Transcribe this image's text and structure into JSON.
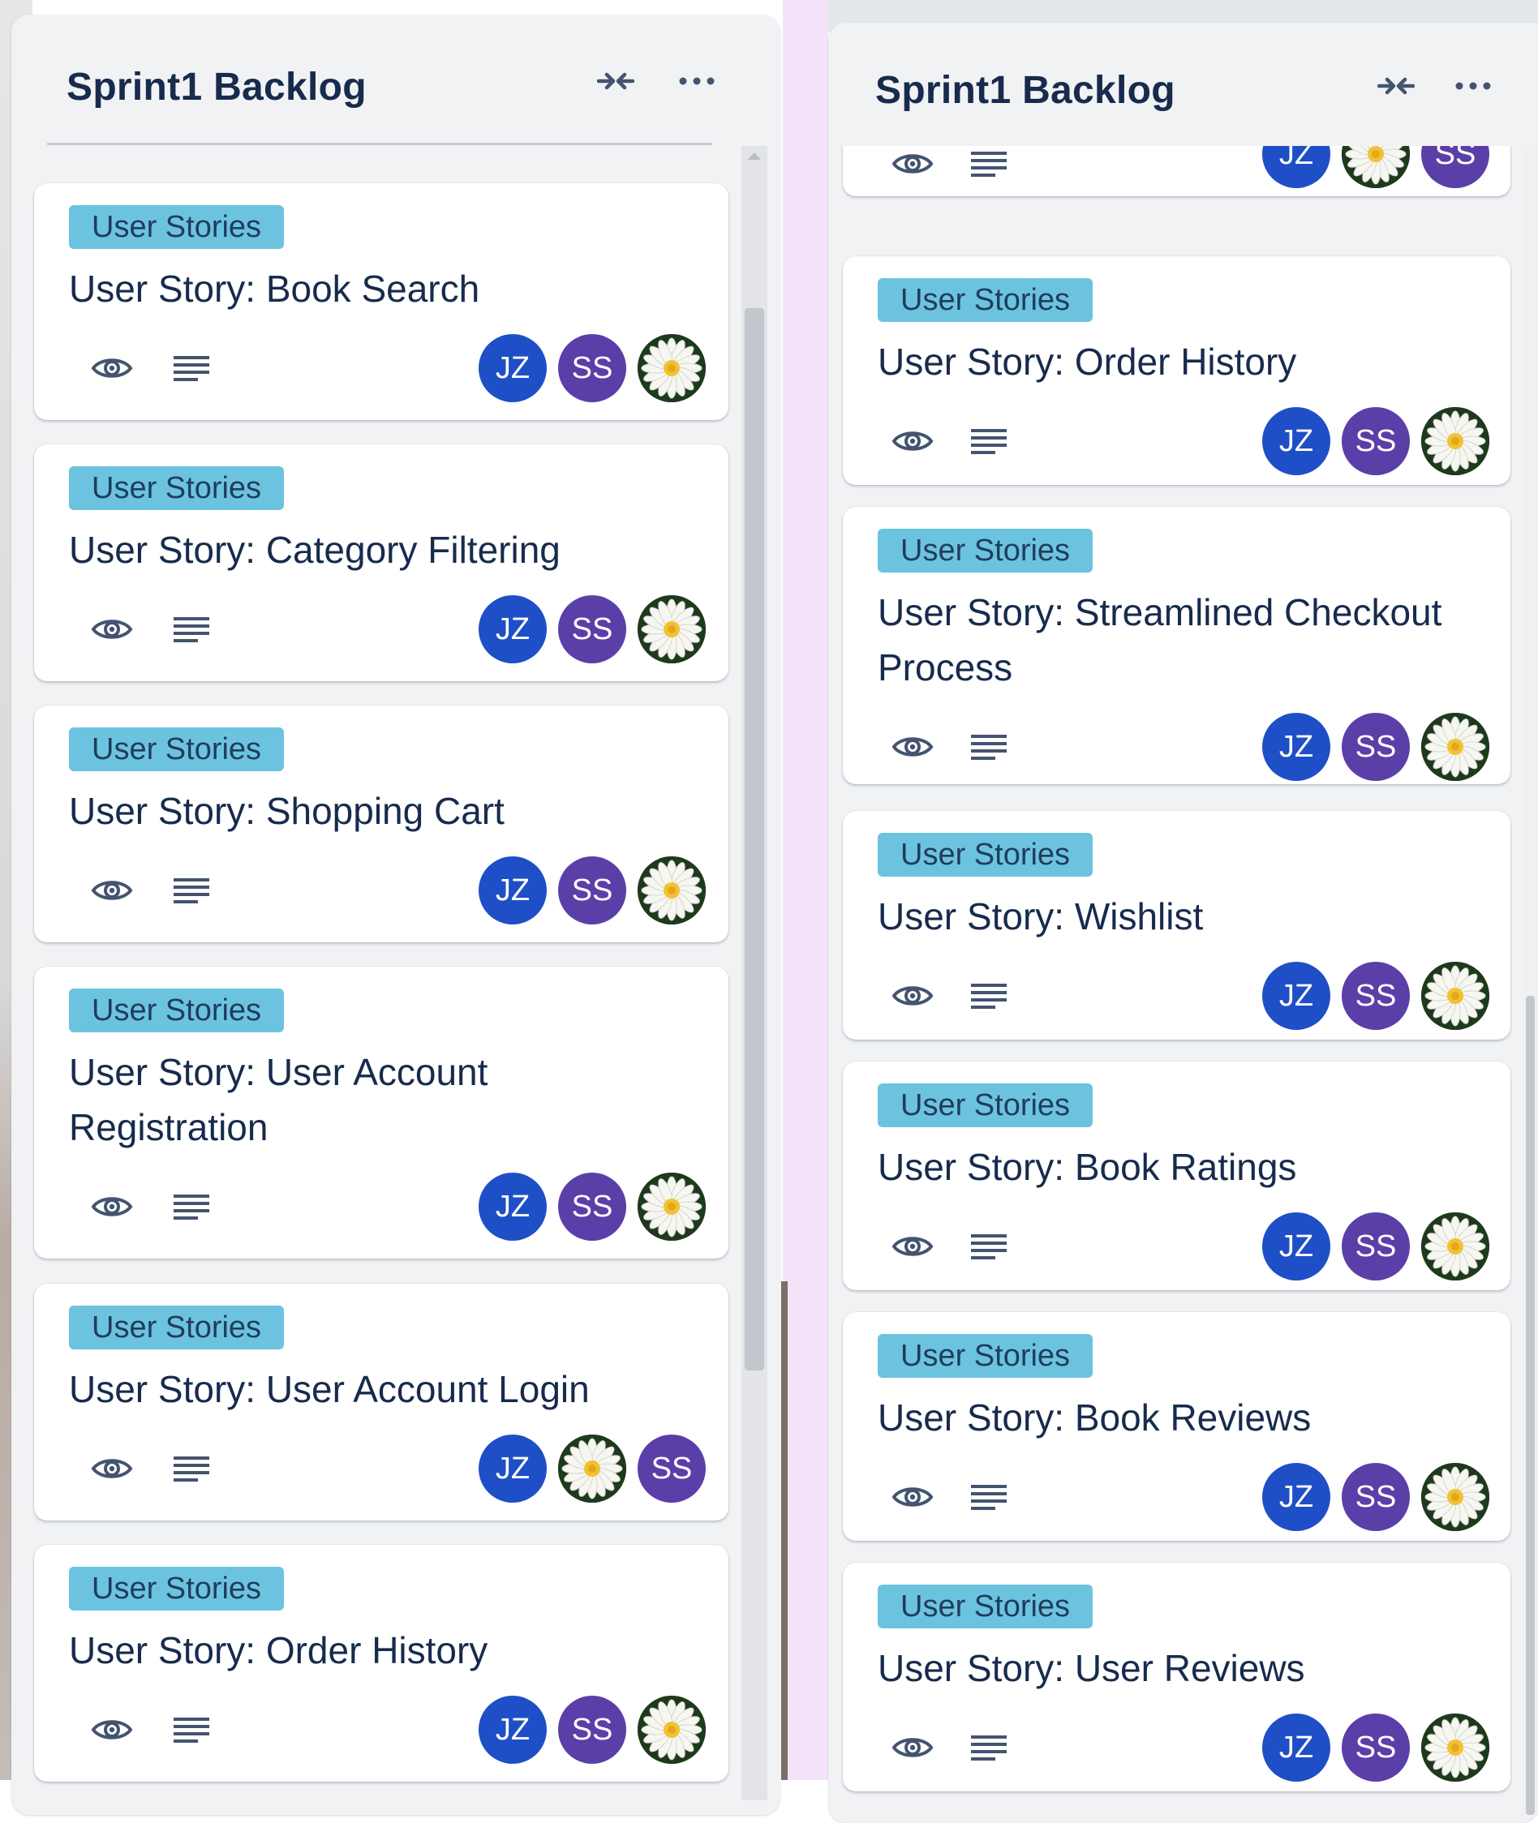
{
  "lists": [
    {
      "title": "Sprint1 Backlog",
      "cards": [
        {
          "label": "User Stories",
          "title": "User Story: Book Search",
          "members": [
            "JZ",
            "SS",
            "photo"
          ]
        },
        {
          "label": "User Stories",
          "title": "User Story: Category Filtering",
          "members": [
            "JZ",
            "SS",
            "photo"
          ]
        },
        {
          "label": "User Stories",
          "title": "User Story: Shopping Cart",
          "members": [
            "JZ",
            "SS",
            "photo"
          ]
        },
        {
          "label": "User Stories",
          "title": "User Story: User Account Registration",
          "members": [
            "JZ",
            "SS",
            "photo"
          ]
        },
        {
          "label": "User Stories",
          "title": "User Story: User Account Login",
          "members": [
            "JZ",
            "photo",
            "SS"
          ]
        },
        {
          "label": "User Stories",
          "title": "User Story: Order History",
          "members": [
            "JZ",
            "SS",
            "photo"
          ]
        }
      ]
    },
    {
      "title": "Sprint1 Backlog",
      "partial_card_members": [
        "JZ",
        "photo",
        "SS"
      ],
      "cards": [
        {
          "label": "User Stories",
          "title": "User Story: Order History",
          "members": [
            "JZ",
            "SS",
            "photo"
          ]
        },
        {
          "label": "User Stories",
          "title": "User Story: Streamlined Checkout Process",
          "members": [
            "JZ",
            "SS",
            "photo"
          ]
        },
        {
          "label": "User Stories",
          "title": "User Story: Wishlist",
          "members": [
            "JZ",
            "SS",
            "photo"
          ]
        },
        {
          "label": "User Stories",
          "title": "User Story: Book Ratings",
          "members": [
            "JZ",
            "SS",
            "photo"
          ]
        },
        {
          "label": "User Stories",
          "title": "User Story: Book Reviews",
          "members": [
            "JZ",
            "SS",
            "photo"
          ]
        },
        {
          "label": "User Stories",
          "title": "User Story: User Reviews",
          "members": [
            "JZ",
            "SS",
            "photo"
          ]
        }
      ]
    }
  ],
  "icons": {
    "watch": "eye-icon",
    "description": "description-lines-icon",
    "collapse": "collapse-arrows-icon",
    "menu": "more-dots-icon"
  },
  "colors": {
    "label_bg": "#6cc3e0",
    "avatar_jz": "#1e4fc7",
    "avatar_ss": "#5b3fa8",
    "list_bg": "#f1f2f4"
  }
}
